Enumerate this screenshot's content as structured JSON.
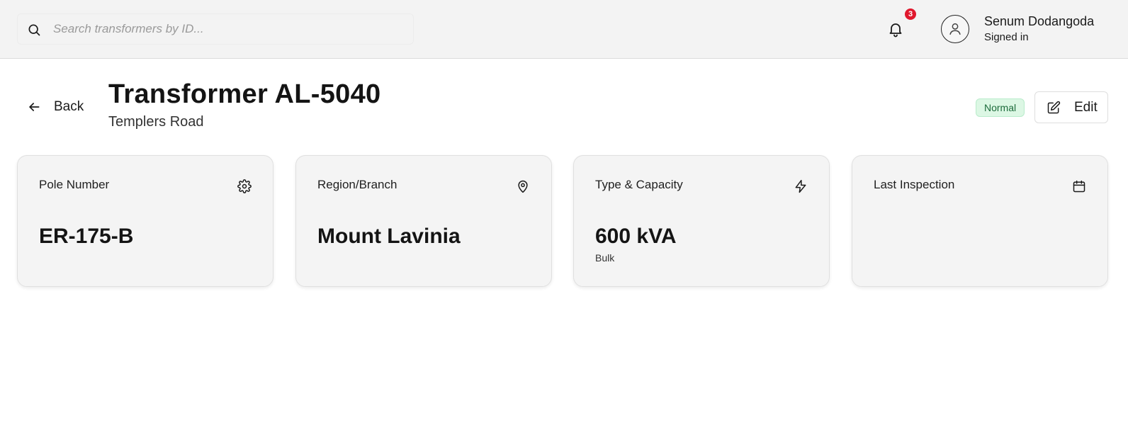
{
  "search": {
    "placeholder": "Search transformers by ID..."
  },
  "notifications": {
    "count": "3",
    "icon": "bell-icon"
  },
  "user": {
    "name": "Senum Dodangoda",
    "status": "Signed in",
    "icon": "user-avatar-icon"
  },
  "header": {
    "back_label": "Back",
    "title": "Transformer AL-5040",
    "subtitle": "Templers Road",
    "status": "Normal",
    "edit_label": "Edit"
  },
  "cards": [
    {
      "label": "Pole Number",
      "value": "ER-175-B",
      "sub": "",
      "icon": "gear-icon"
    },
    {
      "label": "Region/Branch",
      "value": "Mount Lavinia",
      "sub": "",
      "icon": "map-pin-icon"
    },
    {
      "label": "Type & Capacity",
      "value": "600 kVA",
      "sub": "Bulk",
      "icon": "lightning-icon"
    },
    {
      "label": "Last Inspection",
      "value": "",
      "sub": "",
      "icon": "calendar-icon"
    }
  ],
  "colors": {
    "topbar_bg": "#f3f3f3",
    "badge_red": "#e0182d",
    "status_green_bg": "#dcf7e4",
    "status_green_text": "#1d6b3b",
    "card_bg": "#f4f4f4"
  }
}
